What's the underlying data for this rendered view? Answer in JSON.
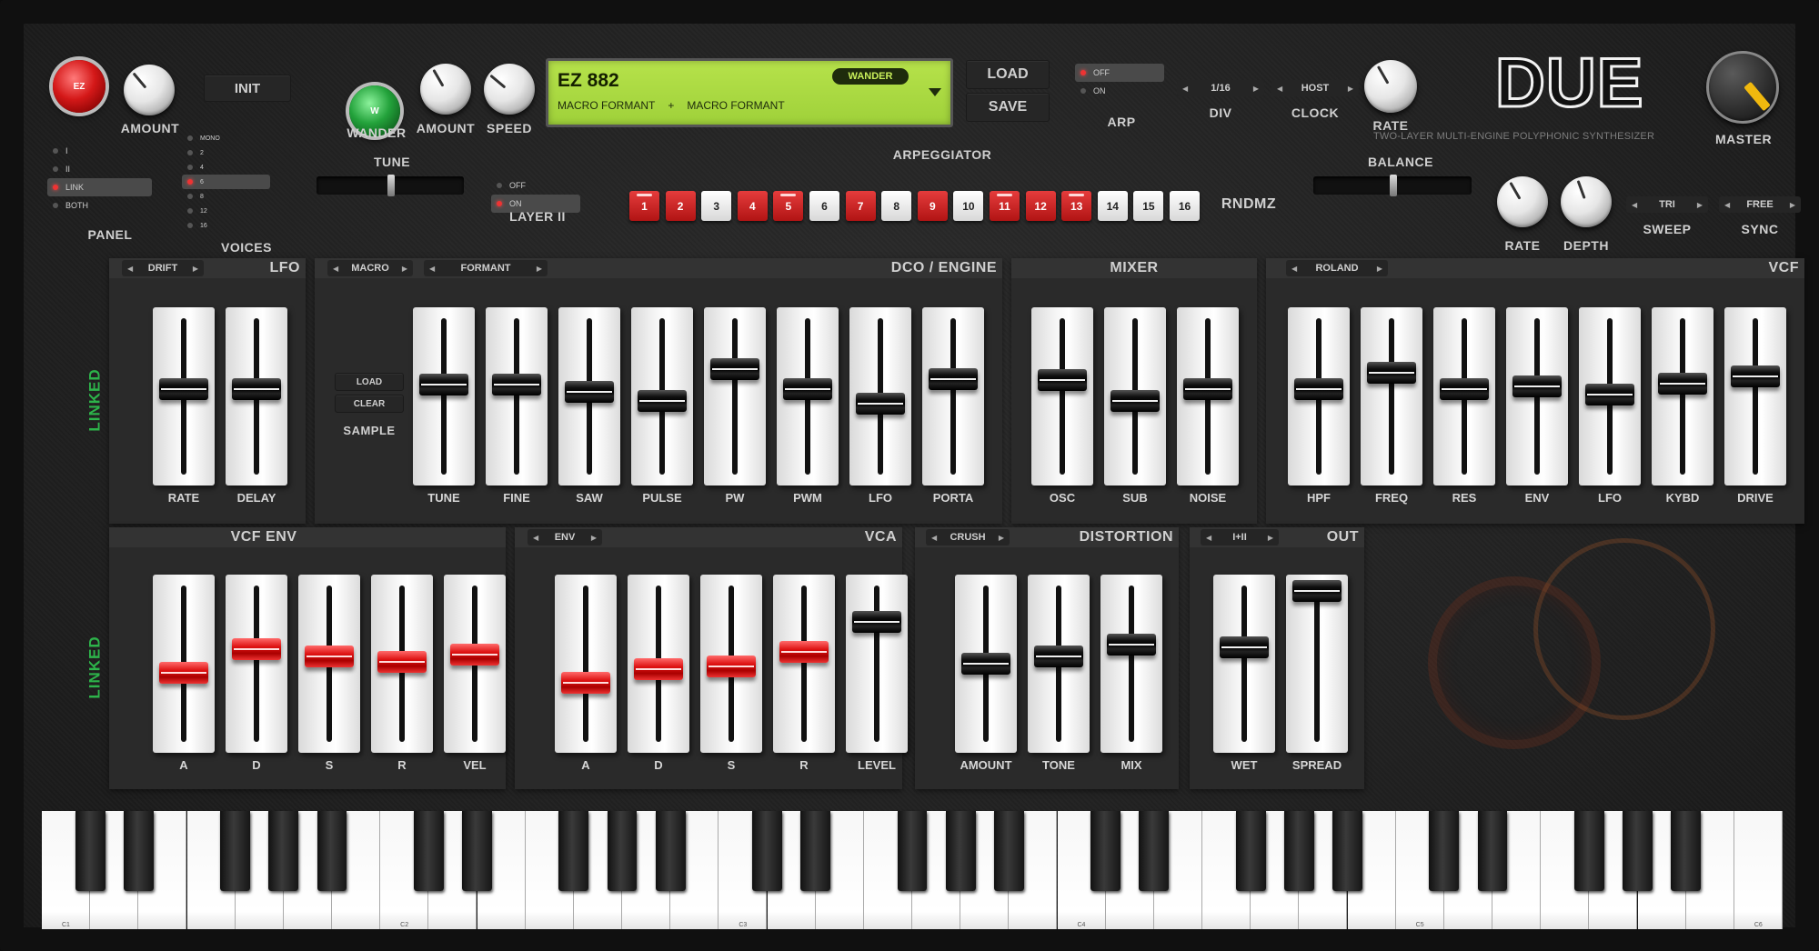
{
  "brand": {
    "logo": "DUE",
    "subtitle": "TWO-LAYER MULTI-ENGINE POLYPHONIC SYNTHESIZER"
  },
  "top": {
    "ez_button": "EZ",
    "amount1": "AMOUNT",
    "init": "INIT",
    "wander_button": "W",
    "wander_label": "WANDER",
    "amount2": "AMOUNT",
    "speed": "SPEED",
    "panel_options": [
      "I",
      "II",
      "LINK",
      "BOTH"
    ],
    "panel_label": "PANEL",
    "voices_options": [
      "MONO",
      "2",
      "4",
      "6",
      "8",
      "12",
      "16"
    ],
    "voices_label": "VOICES",
    "tune_label": "TUNE",
    "layer2_options": [
      "OFF",
      "ON"
    ],
    "layer2_label": "LAYER II",
    "display": {
      "preset": "EZ 882",
      "badge": "WANDER",
      "line_a": "MACRO FORMANT",
      "plus": "+",
      "line_b": "MACRO FORMANT"
    },
    "load": "LOAD",
    "save": "SAVE",
    "arp_options": [
      "OFF",
      "ON"
    ],
    "arp_label": "ARP",
    "div_value": "1/16",
    "div_label": "DIV",
    "clock_value": "HOST",
    "clock_label": "CLOCK",
    "rate_label": "RATE",
    "master_label": "MASTER",
    "arpeggiator_label": "ARPEGGIATOR",
    "steps": [
      "1",
      "2",
      "3",
      "4",
      "5",
      "6",
      "7",
      "8",
      "9",
      "10",
      "11",
      "12",
      "13",
      "14",
      "15",
      "16"
    ],
    "rndmz": "RNDMZ",
    "balance_label": "BALANCE",
    "lfo_rate_label": "RATE",
    "depth_label": "DEPTH",
    "sweep_value": "TRI",
    "sweep_label": "SWEEP",
    "sync_value": "FREE",
    "sync_label": "SYNC"
  },
  "linked": "LINKED",
  "lfo": {
    "title": "LFO",
    "select": "DRIFT",
    "faders": [
      "RATE",
      "DELAY"
    ]
  },
  "dco": {
    "title": "DCO / ENGINE",
    "select_a": "MACRO",
    "select_b": "FORMANT",
    "load": "LOAD",
    "clear": "CLEAR",
    "sample": "SAMPLE",
    "faders": [
      "TUNE",
      "FINE",
      "SAW",
      "PULSE",
      "PW",
      "PWM",
      "LFO",
      "PORTA"
    ]
  },
  "mixer": {
    "title": "MIXER",
    "faders": [
      "OSC",
      "SUB",
      "NOISE"
    ]
  },
  "vcf": {
    "title": "VCF",
    "select": "ROLAND",
    "faders": [
      "HPF",
      "FREQ",
      "RES",
      "ENV",
      "LFO",
      "KYBD",
      "DRIVE"
    ]
  },
  "vcfenv": {
    "title": "VCF ENV",
    "faders": [
      "A",
      "D",
      "S",
      "R",
      "VEL"
    ]
  },
  "vca": {
    "title": "VCA",
    "select": "ENV",
    "faders": [
      "A",
      "D",
      "S",
      "R",
      "LEVEL"
    ]
  },
  "dist": {
    "title": "DISTORTION",
    "select": "CRUSH",
    "faders": [
      "AMOUNT",
      "TONE",
      "MIX"
    ]
  },
  "out": {
    "title": "OUT",
    "select": "I+II",
    "faders": [
      "WET",
      "SPREAD"
    ]
  },
  "keyboard": {
    "octaves": [
      "C1",
      "C2",
      "C3",
      "C4",
      "C5",
      "C6"
    ]
  },
  "colors": {
    "accent_red": "#d11a1a",
    "led_green": "#2db34a",
    "lcd": "#a8d93a",
    "panel": "#2a2a2a"
  }
}
